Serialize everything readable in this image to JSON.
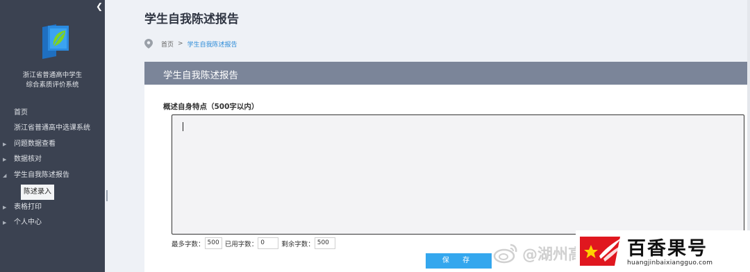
{
  "sidebar": {
    "system_title_line1": "浙江省普通高中学生",
    "system_title_line2": "综合素质评价系统",
    "items": [
      {
        "label": "首页"
      },
      {
        "label": "浙江省普通高中选课系统"
      },
      {
        "label": "问题数据查看"
      },
      {
        "label": "数据核对"
      },
      {
        "label": "学生自我陈述报告"
      },
      {
        "label": "表格打印"
      },
      {
        "label": "个人中心"
      }
    ],
    "active_sub_item": "陈述录入"
  },
  "main": {
    "page_title": "学生自我陈述报告",
    "breadcrumb": {
      "home": "首页",
      "separator": ">",
      "current": "学生自我陈述报告"
    },
    "panel_title": "学生自我陈述报告",
    "field_label": "概述自身特点（500字以内）",
    "textarea_value": "",
    "counter": {
      "max_label": "最多字数：",
      "max_value": "500",
      "used_label": "已用字数：",
      "used_value": "0",
      "remain_label": "剩余字数：",
      "remain_value": "500"
    },
    "save_label": "保 存"
  },
  "watermarks": {
    "weibo_text": "@湖州高",
    "brand_name": "百香果号",
    "brand_url": "huangjinbaixiangguo.com"
  },
  "colors": {
    "sidebar_bg": "#3b4251",
    "panel_header": "#7b8599",
    "accent_blue": "#34a7ee",
    "link_blue": "#2c8bd8"
  }
}
